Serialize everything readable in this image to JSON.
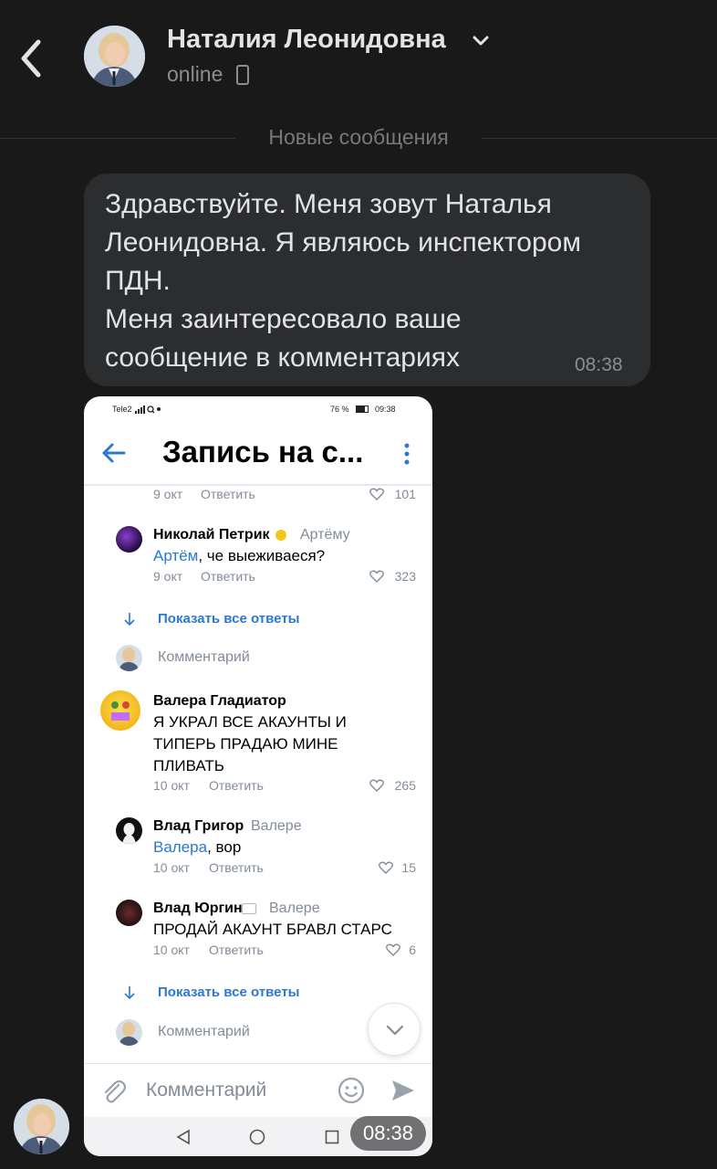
{
  "contact": {
    "name": "Наталия Леонидовна",
    "status": "online"
  },
  "icons": {
    "back": "chevron-left-icon",
    "dropdown": "chevron-down-icon",
    "device": "mobile-phone-icon"
  },
  "divider": {
    "label": "Новые сообщения"
  },
  "message": {
    "lines": [
      "Здравствуйте. Меня зовут Наталья",
      "Леонидовна. Я являюсь инспектором",
      "ПДН.",
      "Меня заинтересовало ваше",
      "сообщение в комментариях"
    ],
    "time": "08:38"
  },
  "screenshot": {
    "statusbar": {
      "carrier": "Tele2",
      "battery": "76 %",
      "clock": "09:38"
    },
    "title": "Запись на с...",
    "top_meta": {
      "date": "9 окт",
      "reply": "Ответить",
      "likes": "101"
    },
    "comments": [
      {
        "author": "Николай Петрик",
        "to": "Артёму",
        "mention": "Артём",
        "text": ", че выеживаеся?",
        "date": "9 окт",
        "reply": "Ответить",
        "likes": "323"
      },
      {
        "author": "Валера Гладиатор",
        "lines": [
          "Я УКРАЛ ВСЕ АКАУНТЫ И",
          "ТИПЕРЬ ПРАДАЮ МИНЕ",
          "ПЛИВАТЬ"
        ],
        "date": "10 окт",
        "reply": "Ответить",
        "likes": "265"
      },
      {
        "author": "Влад Григор",
        "to": "Валере",
        "mention": "Валера",
        "text": ", вор",
        "date": "10 окт",
        "reply": "Ответить",
        "likes": "15"
      },
      {
        "author": "Влад Юргин",
        "to": "Валере",
        "text": "ПРОДАЙ АКАУНТ БРАВЛ СТАРС",
        "date": "10 окт",
        "reply": "Ответить",
        "likes": "6"
      }
    ],
    "show_all": "Показать все ответы",
    "comment_placeholder": "Комментарий",
    "input_placeholder": "Комментарий"
  },
  "photo_time": "08:38",
  "colors": {
    "background": "#19191a",
    "bubble": "#2c2d2e",
    "vk_blue": "#2a78d1",
    "muted": "#818c99"
  }
}
